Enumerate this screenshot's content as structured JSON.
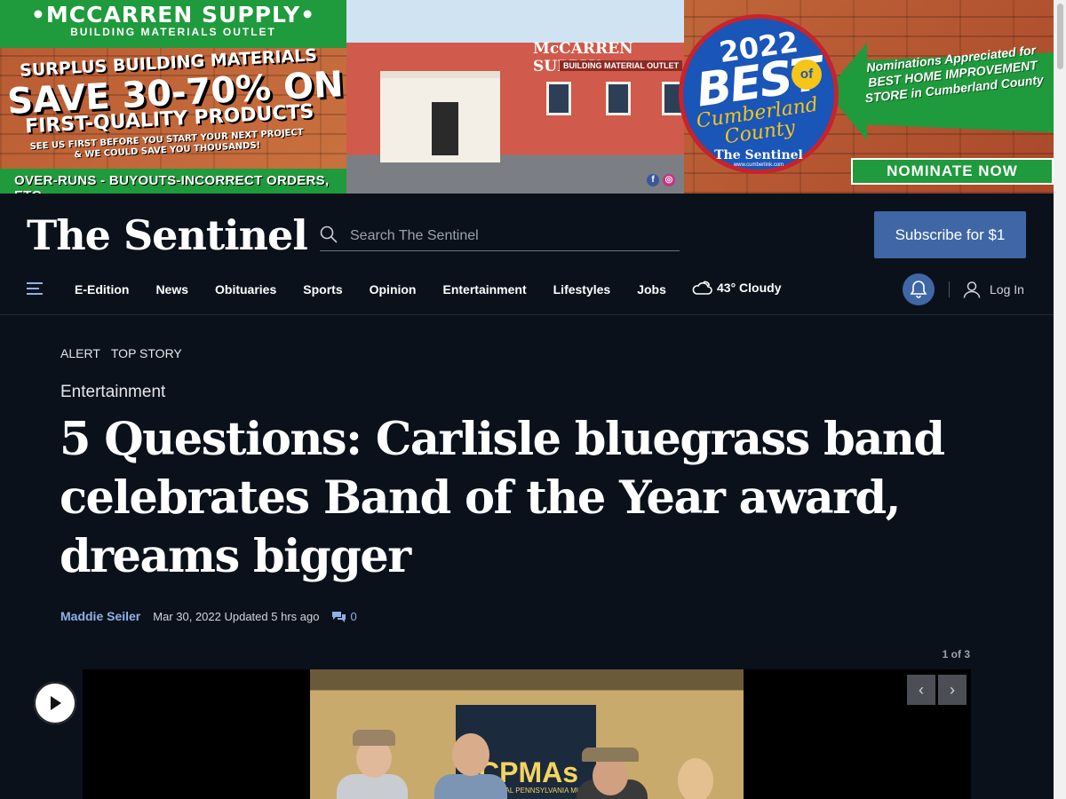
{
  "ad": {
    "brand": "•MCCARREN SUPPLY•",
    "brand_sub": "BUILDING MATERIALS OUTLET",
    "surplus": "SURPLUS BUILDING MATERIALS",
    "save": "SAVE 30-70% ON",
    "first_quality": "FIRST-QUALITY PRODUCTS",
    "see_us": "SEE US FIRST BEFORE YOU START YOUR NEXT PROJECT & WE COULD SAVE YOU THOUSANDS!",
    "overruns": "OVER-RUNS - BUYOUTS-INCORRECT ORDERS, ETC.",
    "store_sign": "McCARREN SUPPLY",
    "store_sign_sub": "BUILDING MATERIAL OUTLET",
    "badge_year": "2022",
    "badge_best": "BEST",
    "badge_of": "of",
    "badge_county": "Cumberland County",
    "badge_paper": "The Sentinel",
    "badge_site": "www.cumberlink.com",
    "nominations": "Nominations Appreciated for BEST HOME IMPROVEMENT STORE in Cumberland County",
    "nominate_button": "NOMINATE NOW",
    "colors": {
      "green": "#1f9a3c",
      "badge_blue": "#1a55b8",
      "badge_red": "#c8232c"
    }
  },
  "header": {
    "logo": "The Sentinel",
    "search_placeholder": "Search The Sentinel",
    "subscribe_label": "Subscribe for $1"
  },
  "nav": {
    "items": [
      "E-Edition",
      "News",
      "Obituaries",
      "Sports",
      "Opinion",
      "Entertainment",
      "Lifestyles",
      "Jobs"
    ],
    "weather": "43° Cloudy",
    "login_label": "Log In",
    "icons": {
      "menu": "hamburger-icon",
      "weather": "cloud-sun-icon",
      "bell": "bell-icon",
      "user": "user-icon"
    }
  },
  "article": {
    "flags": [
      "ALERT",
      "TOP STORY"
    ],
    "section": "Entertainment",
    "headline": "5 Questions: Carlisle bluegrass band celebrates Band of the Year award, dreams bigger",
    "author": "Maddie Seiler",
    "date": "Mar 30, 2022 Updated 5 hrs ago",
    "comment_count": "0"
  },
  "gallery": {
    "counter": "1 of 3",
    "prev_label": "‹",
    "next_label": "›",
    "photo_banner": "CPMAs",
    "photo_banner_sub": "CENTRAL PENNSYLVANIA MUSIC"
  },
  "colors": {
    "background": "#0b111b",
    "accent": "#3f67a6",
    "link": "#8fb2e6"
  }
}
